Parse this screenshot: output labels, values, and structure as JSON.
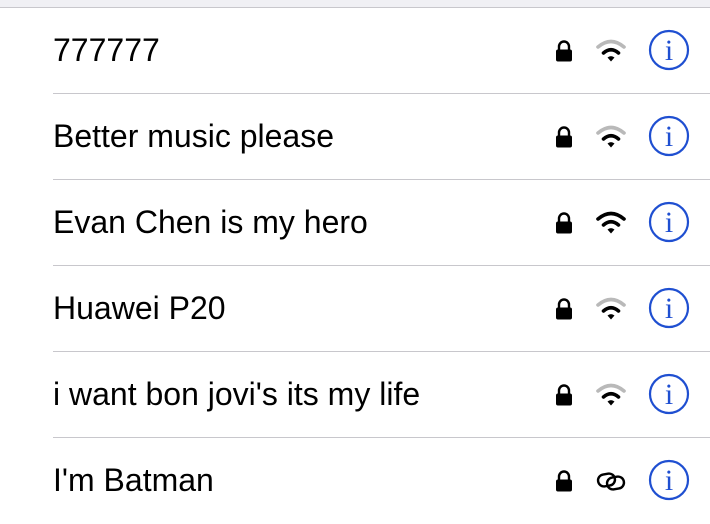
{
  "colors": {
    "accent": "#1f4fd1",
    "divider": "#c8c7cc",
    "signal_strong": "#000000",
    "signal_weak": "#b9b9b9"
  },
  "info_glyph": "i",
  "networks": [
    {
      "ssid": "777777",
      "secured": true,
      "signal": "wifi-2-bars-icon",
      "signal_bars": 2
    },
    {
      "ssid": "Better music please",
      "secured": true,
      "signal": "wifi-2-bars-icon",
      "signal_bars": 2
    },
    {
      "ssid": "Evan Chen is my hero",
      "secured": true,
      "signal": "wifi-3-bars-icon",
      "signal_bars": 3
    },
    {
      "ssid": "Huawei P20",
      "secured": true,
      "signal": "wifi-2-bars-icon",
      "signal_bars": 2
    },
    {
      "ssid": "i want bon jovi's its my life",
      "secured": true,
      "signal": "wifi-2-bars-icon",
      "signal_bars": 2
    },
    {
      "ssid": "I'm Batman",
      "secured": true,
      "signal": "personal-hotspot-link-icon",
      "signal_bars": null
    }
  ]
}
